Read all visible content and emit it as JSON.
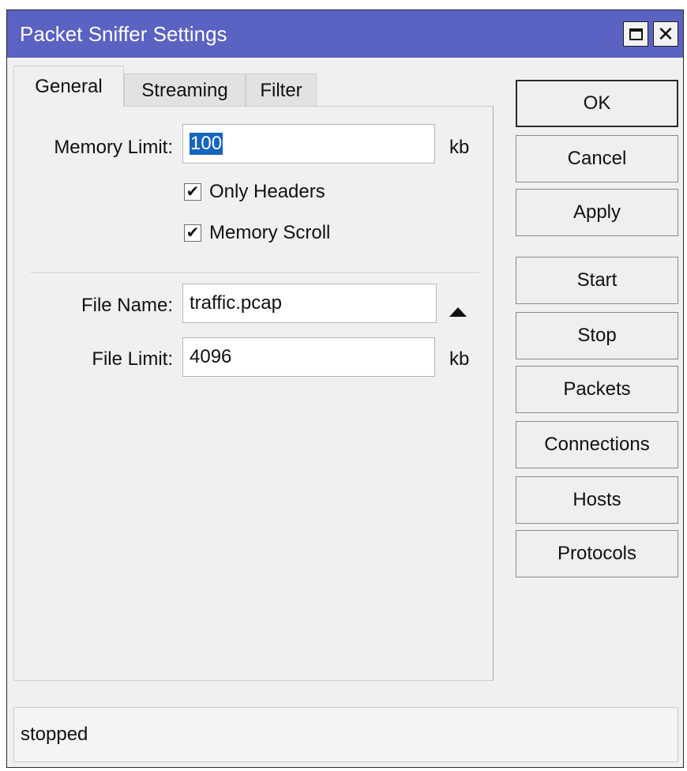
{
  "window": {
    "title": "Packet Sniffer Settings",
    "title_bar_color": "#5a62c2"
  },
  "tabs": [
    {
      "label": "General",
      "active": true
    },
    {
      "label": "Streaming",
      "active": false
    },
    {
      "label": "Filter",
      "active": false
    }
  ],
  "general": {
    "memory_limit": {
      "label": "Memory Limit:",
      "value": "100",
      "unit": "kb",
      "selected": true
    },
    "only_headers": {
      "label": "Only Headers",
      "checked": true
    },
    "memory_scroll": {
      "label": "Memory Scroll",
      "checked": true
    },
    "file_name": {
      "label": "File Name:",
      "value": "traffic.pcap"
    },
    "file_limit": {
      "label": "File Limit:",
      "value": "4096",
      "unit": "kb"
    }
  },
  "buttons": {
    "ok": "OK",
    "cancel": "Cancel",
    "apply": "Apply",
    "start": "Start",
    "stop": "Stop",
    "packets": "Packets",
    "connections": "Connections",
    "hosts": "Hosts",
    "protocols": "Protocols"
  },
  "icons": {
    "maximize": "maximize-icon",
    "close": "close-icon",
    "collapse": "arrow-up-icon",
    "check": "checkmark-icon"
  },
  "status": {
    "text": "stopped"
  }
}
